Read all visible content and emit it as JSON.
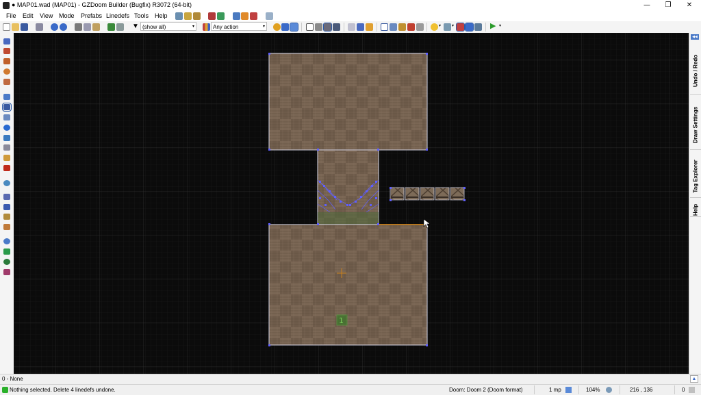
{
  "window": {
    "title": "● MAP01.wad (MAP01) - GZDoom Builder (Bugfix) R3072 (64-bit)",
    "controls": [
      "—",
      "❐",
      "✕"
    ]
  },
  "menu": [
    "File",
    "Edit",
    "View",
    "Mode",
    "Prefabs",
    "Linedefs",
    "Tools",
    "Help"
  ],
  "toolbar": {
    "filter_label": "(show all)",
    "action_label": "Any action",
    "dropdown_arrow": "▾"
  },
  "docker_tabs": [
    "Undo / Redo",
    "Draw Settings",
    "Tag Explorer",
    "Help"
  ],
  "docker_toggle": "◀◀",
  "info_bar": {
    "text": "0 - None",
    "expand_icon": "▲"
  },
  "status": {
    "message": "Nothing selected. Delete 4 linedefs undone.",
    "game": "Doom: Doom 2 (Doom format)",
    "grid": "1 mp",
    "zoom": "104%",
    "coords": "216 , 136",
    "count": "0"
  },
  "colors": {
    "floor": "#7a6654",
    "floor_dark": "#5e4c3d",
    "vertex": "#5f5fff",
    "highlight_line": "#c8801e",
    "player_start": "#4e9a3a"
  }
}
